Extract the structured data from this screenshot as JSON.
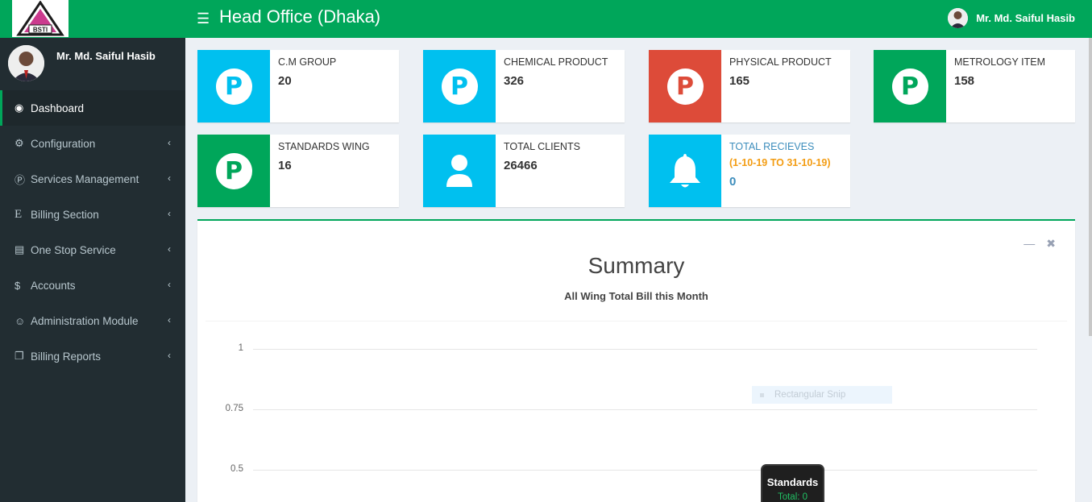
{
  "header": {
    "logo_text": "BSTI",
    "title": "Head Office (Dhaka)",
    "user_name": "Mr. Md. Saiful Hasib"
  },
  "sidebar": {
    "user_name": "Mr. Md. Saiful Hasib",
    "items": [
      {
        "label": "Dashboard",
        "icon": "dashboard-icon",
        "active": true
      },
      {
        "label": "Configuration",
        "icon": "cogs-icon"
      },
      {
        "label": "Services Management",
        "icon": "p-circle-icon"
      },
      {
        "label": "Billing Section",
        "icon": "e-letter-icon"
      },
      {
        "label": "One Stop Service",
        "icon": "list-icon"
      },
      {
        "label": "Accounts",
        "icon": "dollar-icon"
      },
      {
        "label": "Administration Module",
        "icon": "user-circle-icon"
      },
      {
        "label": "Billing Reports",
        "icon": "copy-icon"
      }
    ]
  },
  "info_boxes": [
    {
      "label": "C.M GROUP",
      "value": "20",
      "color": "#00c0ef",
      "icon": "P"
    },
    {
      "label": "CHEMICAL PRODUCT",
      "value": "326",
      "color": "#00c0ef",
      "icon": "P"
    },
    {
      "label": "PHYSICAL PRODUCT",
      "value": "165",
      "color": "#dd4b39",
      "icon": "P"
    },
    {
      "label": "METROLOGY ITEM",
      "value": "158",
      "color": "#00a65a",
      "icon": "P"
    },
    {
      "label": "STANDARDS WING",
      "value": "16",
      "color": "#00a65a",
      "icon": "P"
    },
    {
      "label": "TOTAL CLIENTS",
      "value": "26466",
      "color": "#00c0ef",
      "icon": "user-icon"
    },
    {
      "label": "TOTAL RECIEVES",
      "sub": "(1-10-19 TO 31-10-19)",
      "value": "0",
      "color": "#00c0ef",
      "icon": "bell-icon"
    }
  ],
  "summary": {
    "title": "Summary",
    "subtitle": "All Wing Total Bill this Month",
    "legend_ghost": "Rectangular Snip",
    "tooltip_title": "Standards",
    "tooltip_value": "Total: 0"
  },
  "chart_data": {
    "type": "bar",
    "title": "Summary",
    "subtitle": "All Wing Total Bill this Month",
    "ytick_labels": [
      "1",
      "0.75",
      "0.5"
    ],
    "ylim": [
      0,
      1
    ],
    "categories": [
      "Standards"
    ],
    "values": [
      0
    ],
    "grid": true
  }
}
